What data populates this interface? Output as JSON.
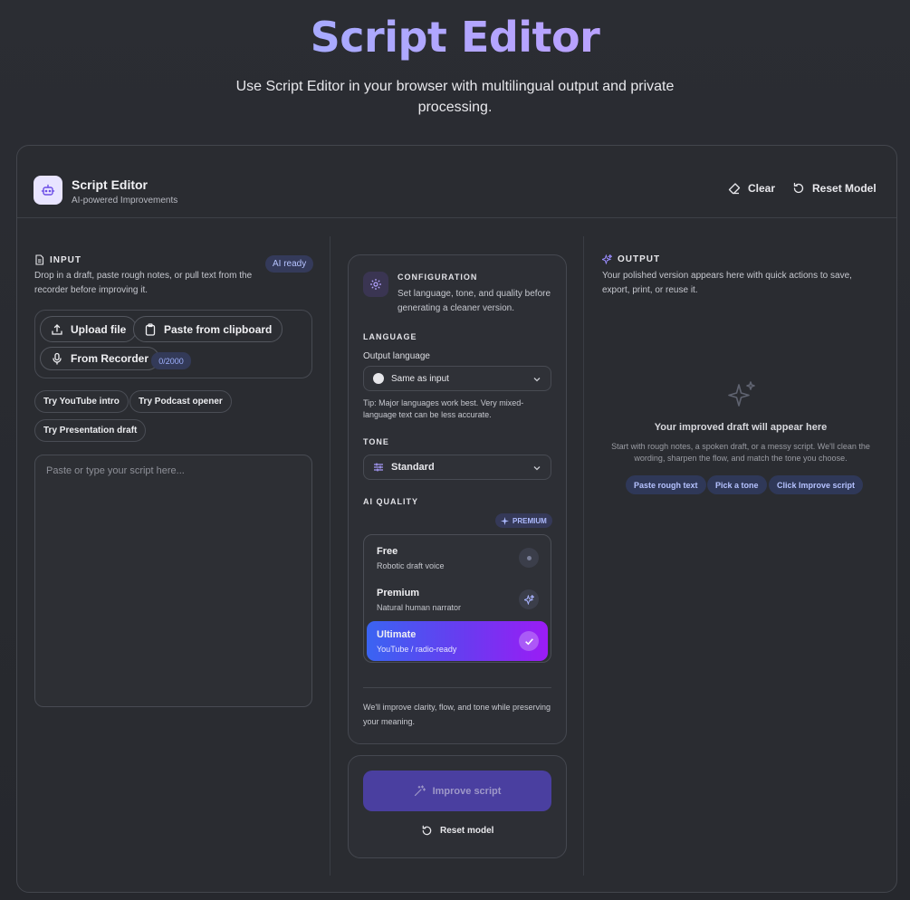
{
  "hero": {
    "title": "Script Editor",
    "subtitle": "Use Script Editor in your browser with multilingual output and private processing."
  },
  "header": {
    "app_name": "Script Editor",
    "app_tagline": "AI-powered Improvements",
    "app_icon": "robot-icon",
    "clear_label": "Clear",
    "reset_label": "Reset Model"
  },
  "input": {
    "heading": "INPUT",
    "description": "Drop in a draft, paste rough notes, or pull text from the recorder before improving it.",
    "status_badge": "AI ready",
    "upload_label": "Upload file",
    "paste_label": "Paste from clipboard",
    "recorder_label": "From Recorder",
    "counter": "0/2000",
    "samples": [
      "Try YouTube intro",
      "Try Podcast opener",
      "Try Presentation draft"
    ],
    "placeholder": "Paste or type your script here..."
  },
  "config": {
    "heading": "CONFIGURATION",
    "description": "Set language, tone, and quality before generating a cleaner version.",
    "language_heading": "LANGUAGE",
    "output_language_label": "Output language",
    "output_language_value": "Same as input",
    "tip": "Tip: Major languages work best. Very mixed-language text can be less accurate.",
    "tone_heading": "TONE",
    "tone_value": "Standard",
    "quality_heading": "AI QUALITY",
    "premium_tag": "PREMIUM",
    "quality_options": [
      {
        "title": "Free",
        "subtitle": "Robotic draft voice",
        "icon": "dot-icon"
      },
      {
        "title": "Premium",
        "subtitle": "Natural human narrator",
        "icon": "sparkle-icon"
      },
      {
        "title": "Ultimate",
        "subtitle": "YouTube / radio-ready",
        "icon": "check-icon",
        "selected": true
      }
    ],
    "footer": "We'll improve clarity, flow, and tone while preserving your meaning."
  },
  "actions": {
    "improve_label": "Improve script",
    "reset_label": "Reset model"
  },
  "output": {
    "heading": "OUTPUT",
    "description": "Your polished version appears here with quick actions to save, export, print, or reuse it.",
    "empty_title": "Your improved draft will appear here",
    "empty_desc": "Start with rough notes, a spoken draft, or a messy script. We'll clean the wording, sharpen the flow, and match the tone you choose.",
    "hints": [
      "Paste rough text",
      "Pick a tone",
      "Click Improve script"
    ]
  },
  "colors": {
    "accent": "#6a3af0",
    "title_gradient_start": "#93b4ff",
    "title_gradient_end": "#c49cff",
    "selected_gradient_start": "#3a64f2",
    "selected_gradient_end": "#9b1cf5"
  }
}
